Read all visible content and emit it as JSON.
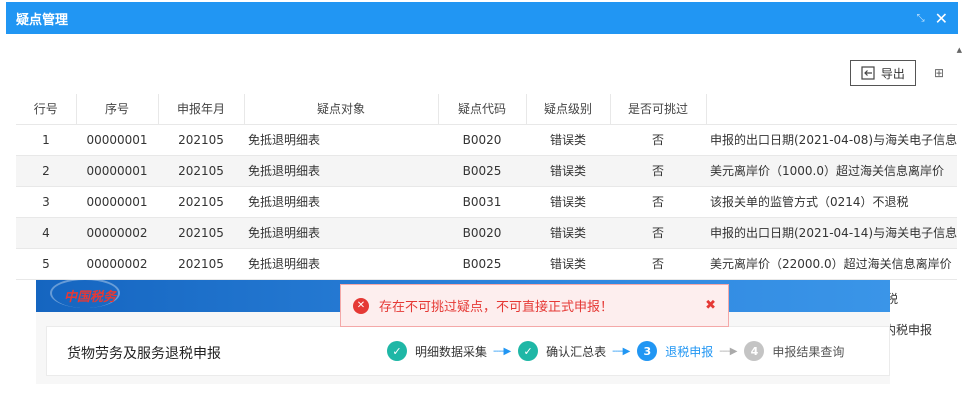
{
  "window": {
    "title": "疑点管理",
    "resize_icon": "resize-icon",
    "close_icon": "close-icon",
    "resize_glyph": "⤡",
    "close_glyph": "✕"
  },
  "toolbar": {
    "export_label": "导出",
    "columns_icon": "columns-icon",
    "columns_glyph": "⊞"
  },
  "table": {
    "headers": [
      "行号",
      "序号",
      "申报年月",
      "疑点对象",
      "疑点代码",
      "疑点级别",
      "是否可挑过",
      ""
    ],
    "rows": [
      [
        "1",
        "00000001",
        "202105",
        "免抵退明细表",
        "B0020",
        "错误类",
        "否",
        "申报的出口日期(2021-04-08)与海关电子信息"
      ],
      [
        "2",
        "00000001",
        "202105",
        "免抵退明细表",
        "B0025",
        "错误类",
        "否",
        "美元离岸价（1000.0）超过海关信息离岸价"
      ],
      [
        "3",
        "00000001",
        "202105",
        "免抵退明细表",
        "B0031",
        "错误类",
        "否",
        "该报关单的监管方式（0214）不退税"
      ],
      [
        "4",
        "00000002",
        "202105",
        "免抵退明细表",
        "B0020",
        "错误类",
        "否",
        "申报的出口日期(2021-04-14)与海关电子信息"
      ],
      [
        "5",
        "00000002",
        "202105",
        "免抵退明细表",
        "B0025",
        "错误类",
        "否",
        "美元离岸价（22000.0）超过海关信息离岸价"
      ]
    ],
    "partial_right_cells": [
      "税",
      "内税申报"
    ]
  },
  "overlay": {
    "logo_text": "中国税务",
    "page_title": "货物劳务及服务退税申报",
    "steps": [
      {
        "label": "明细数据采集",
        "status": "done",
        "icon": "check-icon",
        "glyph": "✓"
      },
      {
        "label": "确认汇总表",
        "status": "done",
        "icon": "check-icon",
        "glyph": "✓"
      },
      {
        "label": "退税申报",
        "status": "active",
        "icon": "step-3-icon",
        "glyph": "3"
      },
      {
        "label": "申报结果查询",
        "status": "todo",
        "icon": "step-4-icon",
        "glyph": "4"
      }
    ],
    "arrow_glyph": "----▶"
  },
  "alert": {
    "message": "存在不可挑过疑点，不可直接正式申报！",
    "icon": "error-x-icon",
    "icon_glyph": "✕",
    "close_glyph": "✖"
  },
  "colors": {
    "titlebar": "#2196f3",
    "alert_text": "#e53935",
    "step_done": "#1fb7a6",
    "step_active": "#2196f3"
  }
}
